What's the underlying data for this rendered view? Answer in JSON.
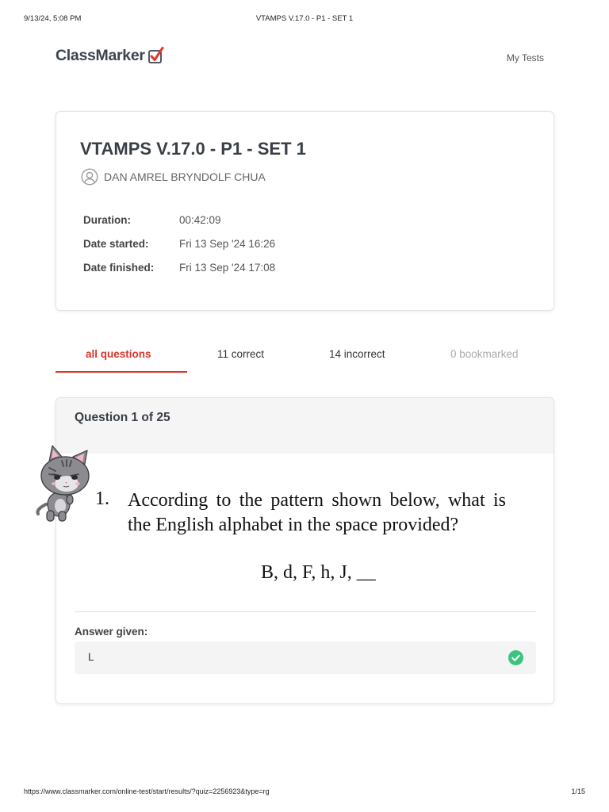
{
  "print_header": {
    "datetime": "9/13/24, 5:08 PM",
    "title": "VTAMPS V.17.0 - P1 - SET 1"
  },
  "brand": {
    "name": "ClassMarker",
    "check_color": "#e0392b"
  },
  "nav": {
    "my_tests": "My Tests"
  },
  "summary": {
    "title": "VTAMPS V.17.0 - P1 - SET 1",
    "user_name": "DAN AMREL BRYNDOLF CHUA",
    "fields": [
      {
        "label": "Duration:",
        "value": "00:42:09"
      },
      {
        "label": "Date started:",
        "value": "Fri 13 Sep '24 16:26"
      },
      {
        "label": "Date finished:",
        "value": "Fri 13 Sep '24 17:08"
      }
    ]
  },
  "tabs": [
    {
      "label": "all questions",
      "state": "active"
    },
    {
      "label": "11 correct",
      "state": "normal"
    },
    {
      "label": "14 incorrect",
      "state": "normal"
    },
    {
      "label": "0 bookmarked",
      "state": "disabled"
    }
  ],
  "question": {
    "header": "Question 1 of 25",
    "number": "1.",
    "text": "According to the pattern shown below, what is the English alphabet in the space provided?",
    "sequence": "B, d, F, h, J, __",
    "answer_label": "Answer given:",
    "answer_value": "L",
    "answer_status": "correct",
    "correct_color": "#3cc47c"
  },
  "print_footer": {
    "url": "https://www.classmarker.com/online-test/start/results/?quiz=2256923&type=rg",
    "page": "1/15"
  },
  "colors": {
    "accent": "#d9362b",
    "text_dark": "#3a3f47"
  }
}
